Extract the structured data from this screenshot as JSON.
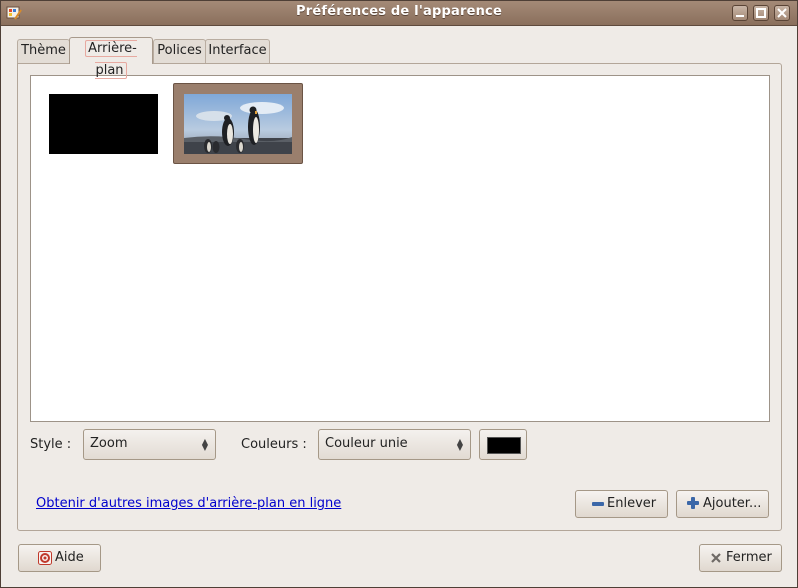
{
  "window": {
    "title": "Préférences de l'apparence"
  },
  "tabs": [
    {
      "label": "Thème"
    },
    {
      "label": "Arrière-plan"
    },
    {
      "label": "Polices"
    },
    {
      "label": "Interface"
    }
  ],
  "background": {
    "style_label": "Style :",
    "style_value": "Zoom",
    "colors_label": "Couleurs :",
    "colors_value": "Couleur unie",
    "solid_color": "#000000",
    "more_link": "Obtenir d'autres images d'arrière-plan en ligne",
    "remove_label": "Enlever",
    "add_label": "Ajouter..."
  },
  "footer": {
    "help_label": "Aide",
    "close_label": "Fermer"
  },
  "icons": {
    "app": "appearance-icon",
    "minimize": "minimize-icon",
    "maximize": "maximize-icon",
    "close": "close-icon",
    "remove": "minus-icon",
    "add": "plus-icon",
    "help": "help-icon",
    "fermer": "close-x-icon"
  }
}
